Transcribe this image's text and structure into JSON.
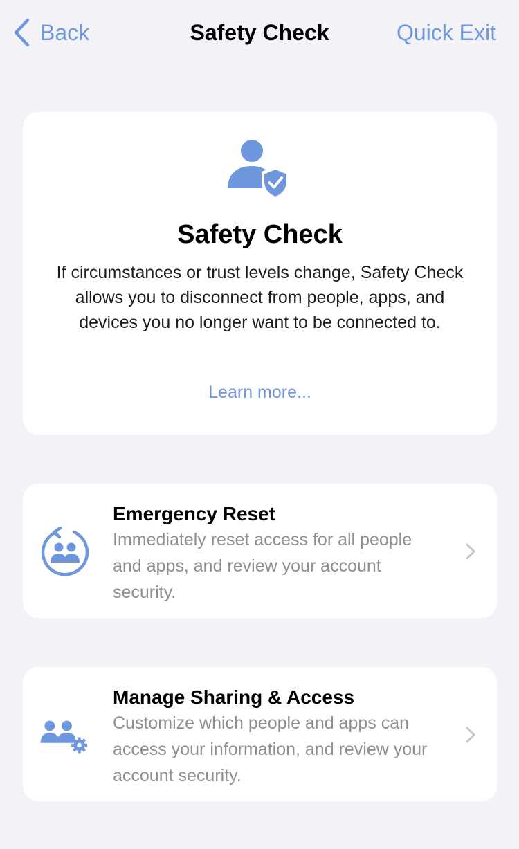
{
  "nav": {
    "back_label": "Back",
    "title": "Safety Check",
    "quick_exit_label": "Quick Exit"
  },
  "hero": {
    "icon": "person-shield-check-icon",
    "title": "Safety Check",
    "description": "If circumstances or trust levels change, Safety Check allows you to disconnect from people, apps, and devices you no longer want to be connected to.",
    "learn_more_label": "Learn more..."
  },
  "options": [
    {
      "icon": "emergency-reset-icon",
      "title": "Emergency Reset",
      "description": "Immediately reset access for all people and apps, and review your account security."
    },
    {
      "icon": "manage-sharing-icon",
      "title": "Manage Sharing & Access",
      "description": "Customize which people and apps can access your information, and review your account security."
    }
  ],
  "colors": {
    "accent": "#6f97de",
    "background": "#f2f2f7",
    "card": "#ffffff",
    "secondary_text": "#8e8e93",
    "chevron": "#c4c4c9"
  }
}
